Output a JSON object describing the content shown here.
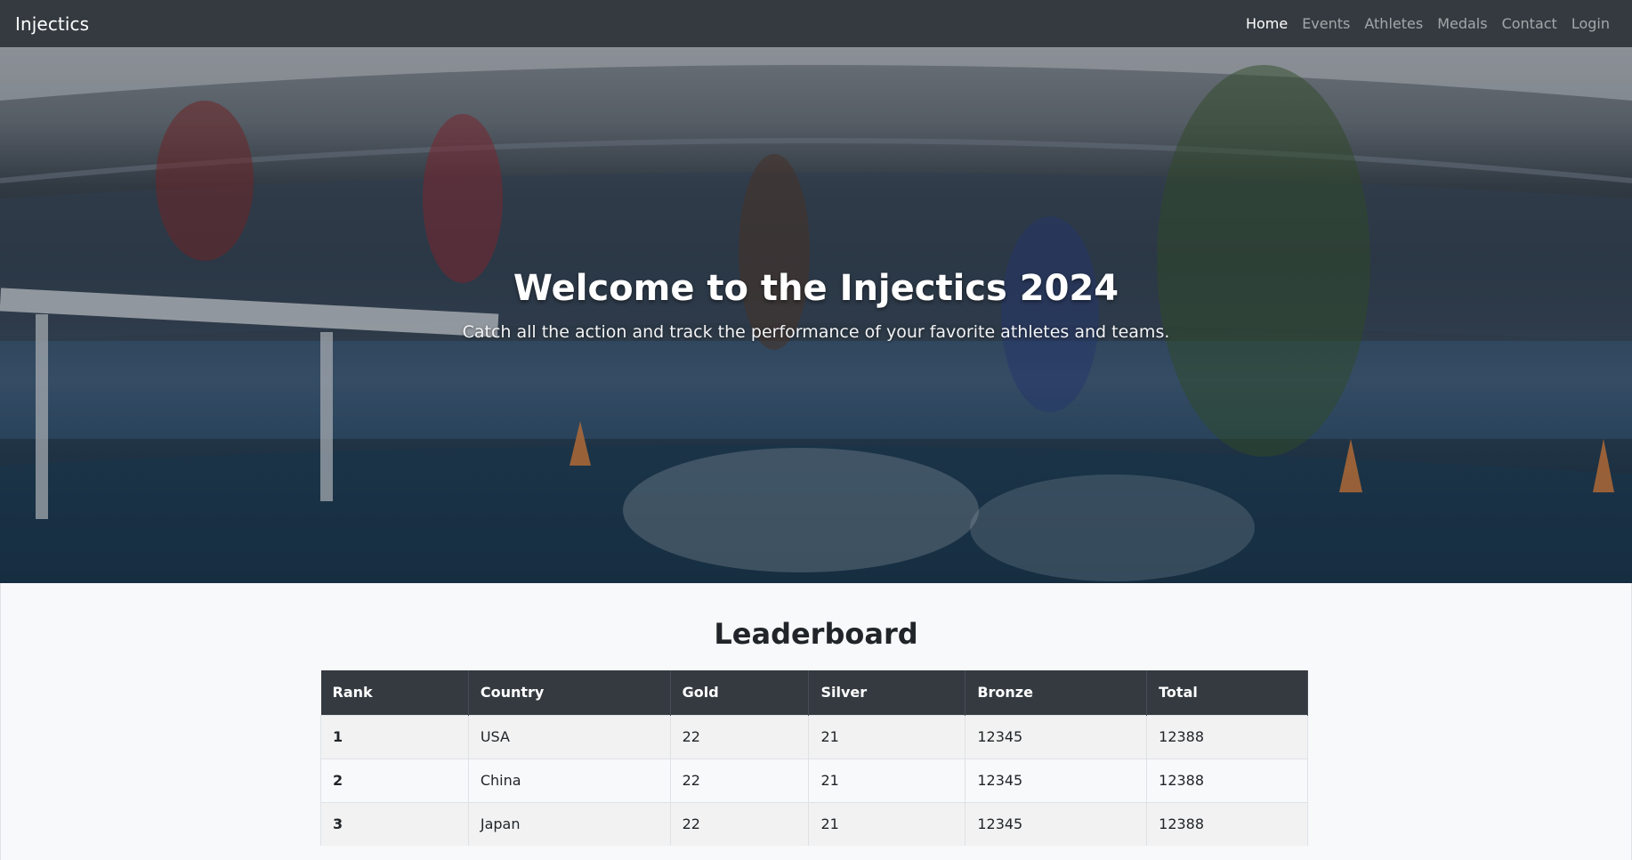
{
  "navbar": {
    "brand": "Injectics",
    "links": [
      {
        "label": "Home",
        "active": true
      },
      {
        "label": "Events",
        "active": false
      },
      {
        "label": "Athletes",
        "active": false
      },
      {
        "label": "Medals",
        "active": false
      },
      {
        "label": "Contact",
        "active": false
      },
      {
        "label": "Login",
        "active": false
      }
    ]
  },
  "hero": {
    "title": "Welcome to the Injectics 2024",
    "subtitle": "Catch all the action and track the performance of your favorite athletes and teams."
  },
  "leaderboard": {
    "title": "Leaderboard",
    "columns": [
      "Rank",
      "Country",
      "Gold",
      "Silver",
      "Bronze",
      "Total"
    ],
    "rows": [
      [
        "1",
        "USA",
        "22",
        "21",
        "12345",
        "12388"
      ],
      [
        "2",
        "China",
        "22",
        "21",
        "12345",
        "12388"
      ],
      [
        "3",
        "Japan",
        "22",
        "21",
        "12345",
        "12388"
      ]
    ]
  },
  "colors": {
    "navbar": "#343a40",
    "page_background": "#f8f9fa",
    "table_header": "#343a40"
  }
}
